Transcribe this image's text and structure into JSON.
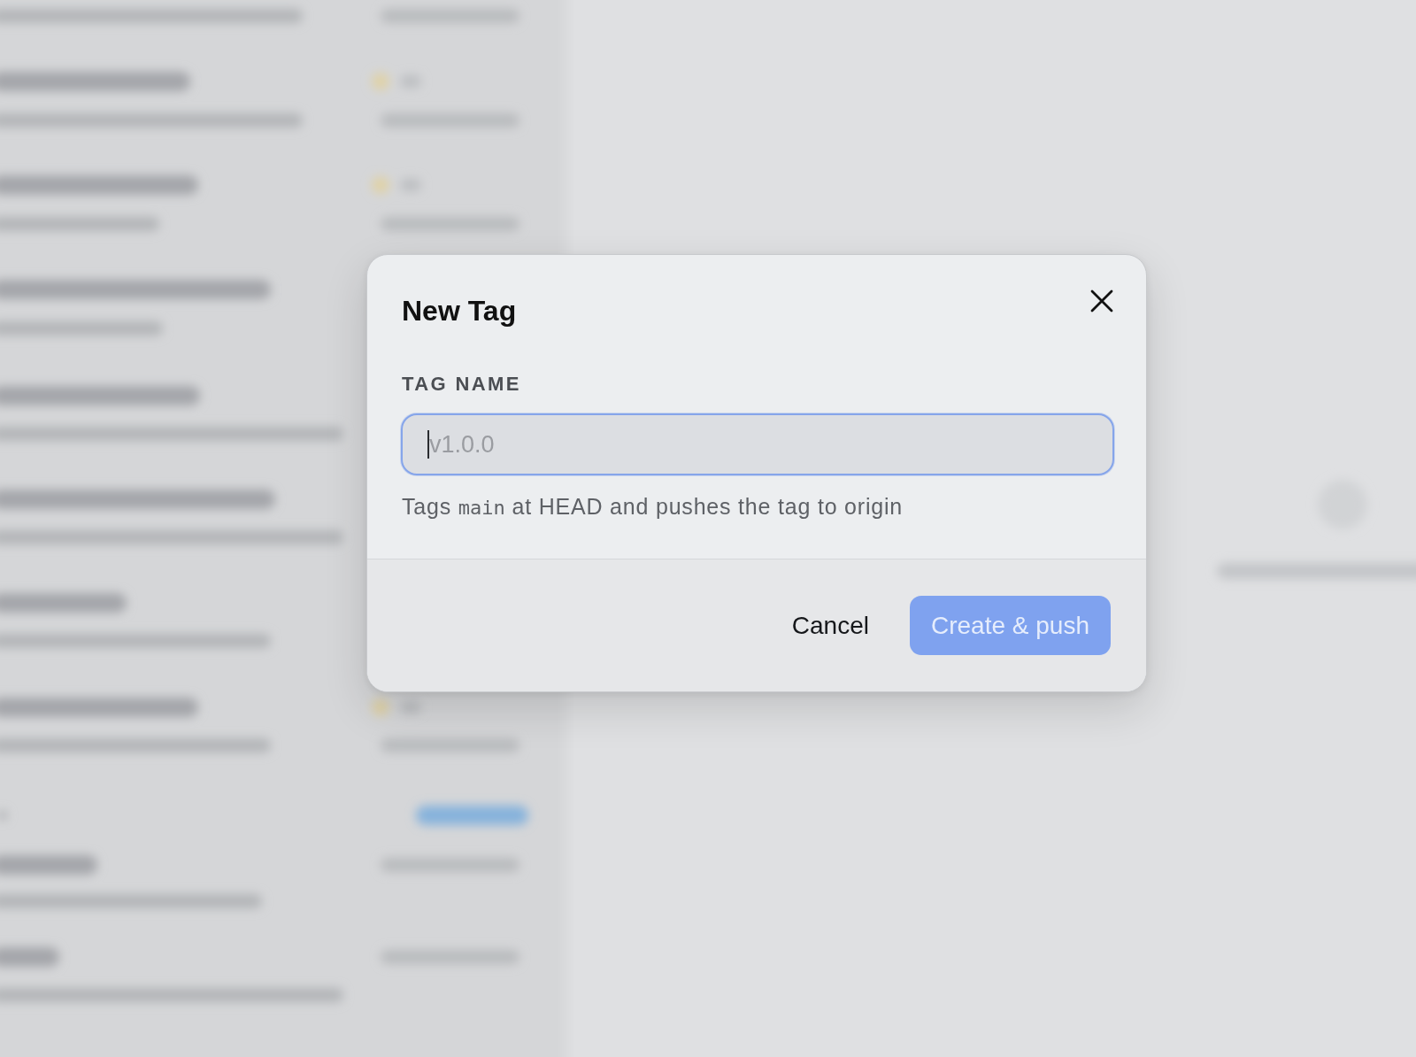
{
  "dialog": {
    "title": "New Tag",
    "field": {
      "label": "TAG NAME",
      "placeholder": "v1.0.0",
      "focused": true
    },
    "hint": [
      {
        "kind": "text",
        "text": "Tags "
      },
      {
        "kind": "code",
        "text": "main"
      },
      {
        "kind": "text",
        "text": " at HEAD and pushes the tag to origin"
      }
    ],
    "buttons": [
      {
        "kind": "plain",
        "label": "Cancel",
        "disabled": false
      },
      {
        "kind": "primary",
        "label": "Create & push",
        "disabled": true
      }
    ]
  }
}
